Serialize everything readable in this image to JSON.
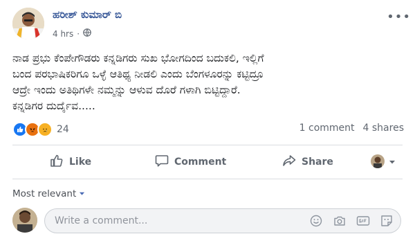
{
  "post": {
    "author": "ಹರೀಶ್ ಕುಮಾರ್ ಬಿ",
    "time": "4 hrs",
    "privacy_icon": "globe-icon",
    "lines": [
      "ನಾಡ ಪ್ರಭು ಕೆಂಪೇಗೌಡರು ಕನ್ನಡಿಗರು ಸುಖ ಭೋಗದಿಂದ ಬದುಕಲಿ, ಇಲ್ಲಿಗೆ",
      "ಬಂದ ಪರಭಾಷಿಕರಿಗೂ ಒಳ್ಳೆ ಆತಿಥ್ಯ ನೀಡಲಿ ಎಂದು ಬೆಂಗಳೂರನ್ನು ಕಟ್ಟಿದ್ರೂ",
      "ಆದ್ರೇ ಇಂದು ಅತಿಥಿಗಳೇ ನಮ್ಮನ್ನು ಆಳುವ ದೊರೆ ಗಳಾಗಿ ಬಿಟ್ಟಿದ್ದಾರೆ.",
      "ಕನ್ನಡಿಗರ ದುರ್ದೈವ....."
    ]
  },
  "reactions": {
    "count": "24",
    "types": [
      "like-reaction-icon",
      "angry-reaction-icon",
      "sad-reaction-icon"
    ],
    "colors": {
      "like": "#1877f2",
      "angry": "#e9710f",
      "sad": "#f7b125"
    }
  },
  "stats": {
    "comments": "1 comment",
    "shares": "4 shares"
  },
  "actions": {
    "like": "Like",
    "comment": "Comment",
    "share": "Share"
  },
  "comments": {
    "sort_label": "Most relevant",
    "placeholder": "Write a comment..."
  },
  "colors": {
    "author_link": "#385898",
    "secondary_text": "#606770",
    "divider": "#dadde1"
  }
}
